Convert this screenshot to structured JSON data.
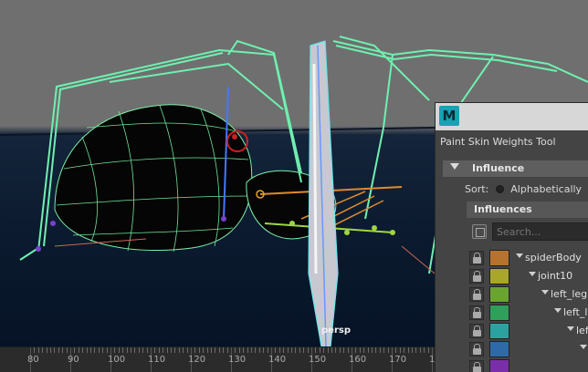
{
  "viewport": {
    "camera_label": "persp"
  },
  "timeslider": {
    "labels": [
      "80",
      "90",
      "100",
      "110",
      "120",
      "130",
      "140",
      "150",
      "160",
      "170",
      "18"
    ]
  },
  "panel": {
    "logo_letter": "M",
    "title": "Paint Skin Weights Tool",
    "influence_header": "Influence",
    "sort_label": "Sort:",
    "sort_option_alpha": "Alphabetically",
    "influences_header": "Influences",
    "search_placeholder": "Search...",
    "influences": [
      {
        "name": "spiderBody",
        "color": "#b5732f",
        "expanded": true
      },
      {
        "name": "joint10",
        "color": "#a9a72a",
        "expanded": true
      },
      {
        "name": "left_legE",
        "color": "#6aa532",
        "expanded": true
      },
      {
        "name": "left_l",
        "color": "#2f9f5a",
        "expanded": true
      },
      {
        "name": "lef",
        "color": "#2aa3a0",
        "expanded": true
      },
      {
        "name": "",
        "color": "#2f6aa8",
        "expanded": true
      },
      {
        "name": "",
        "color": "#7a2fa8",
        "expanded": false
      }
    ]
  }
}
